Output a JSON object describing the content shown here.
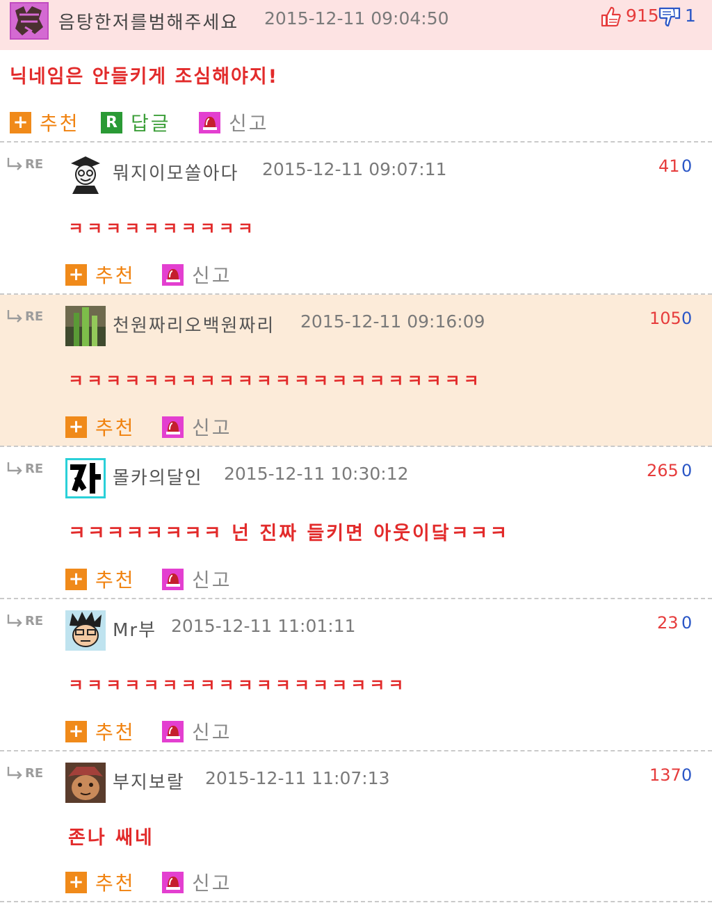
{
  "post": {
    "nickname": "음탕한저를범해주세요",
    "timestamp": "2015-12-11 09:04:50",
    "upvotes": "915",
    "downvotes": "1",
    "body": "닉네임은 안들키게 조심해야지!",
    "actions": {
      "recommend": "추천",
      "reply": "답글",
      "report": "신고"
    },
    "icons": {
      "upvote": "thumbs-up-icon",
      "downvote": "thumbs-down-icon",
      "recommend": "plus-icon",
      "reply": "reply-r-icon",
      "report": "siren-icon"
    }
  },
  "comments": [
    {
      "re": "RE",
      "nickname": "뭐지이모쏠아다",
      "timestamp": "2015-12-11 09:07:11",
      "upvotes": "41",
      "downvotes": "0",
      "body": "ㅋㅋㅋㅋㅋㅋㅋㅋㅋㅋ",
      "recommend": "추천",
      "report": "신고"
    },
    {
      "re": "RE",
      "nickname": "천원짜리오백원짜리",
      "timestamp": "2015-12-11 09:16:09",
      "upvotes": "105",
      "downvotes": "0",
      "body": "ㅋㅋㅋㅋㅋㅋㅋㅋㅋㅋㅋㅋㅋㅋㅋㅋㅋㅋㅋㅋㅋㅋ",
      "recommend": "추천",
      "report": "신고"
    },
    {
      "re": "RE",
      "nickname": "몰카의달인",
      "timestamp": "2015-12-11 10:30:12",
      "upvotes": "265",
      "downvotes": "0",
      "body": "ㅋㅋㅋㅋㅋㅋㅋㅋ 넌 진짜 들키면 아웃이닼ㅋㅋㅋ",
      "recommend": "추천",
      "report": "신고"
    },
    {
      "re": "RE",
      "nickname": "Mr부",
      "timestamp": "2015-12-11 11:01:11",
      "upvotes": "23",
      "downvotes": "0",
      "body": "ㅋㅋㅋㅋㅋㅋㅋㅋㅋㅋㅋㅋㅋㅋㅋㅋㅋㅋ",
      "recommend": "추천",
      "report": "신고"
    },
    {
      "re": "RE",
      "nickname": "부지보랄",
      "timestamp": "2015-12-11 11:07:13",
      "upvotes": "137",
      "downvotes": "0",
      "body": "존나 쌔네",
      "recommend": "추천",
      "report": "신고"
    }
  ],
  "colors": {
    "header_bg": "#fde3e3",
    "highlight_bg": "#fcebd9",
    "body_red": "#e22b2b",
    "upvote_red": "#e63c3c",
    "downvote_blue": "#2a56c6",
    "recommend_orange": "#f08a1a",
    "reply_green": "#2a9a35",
    "report_magenta": "#e33fd0"
  }
}
